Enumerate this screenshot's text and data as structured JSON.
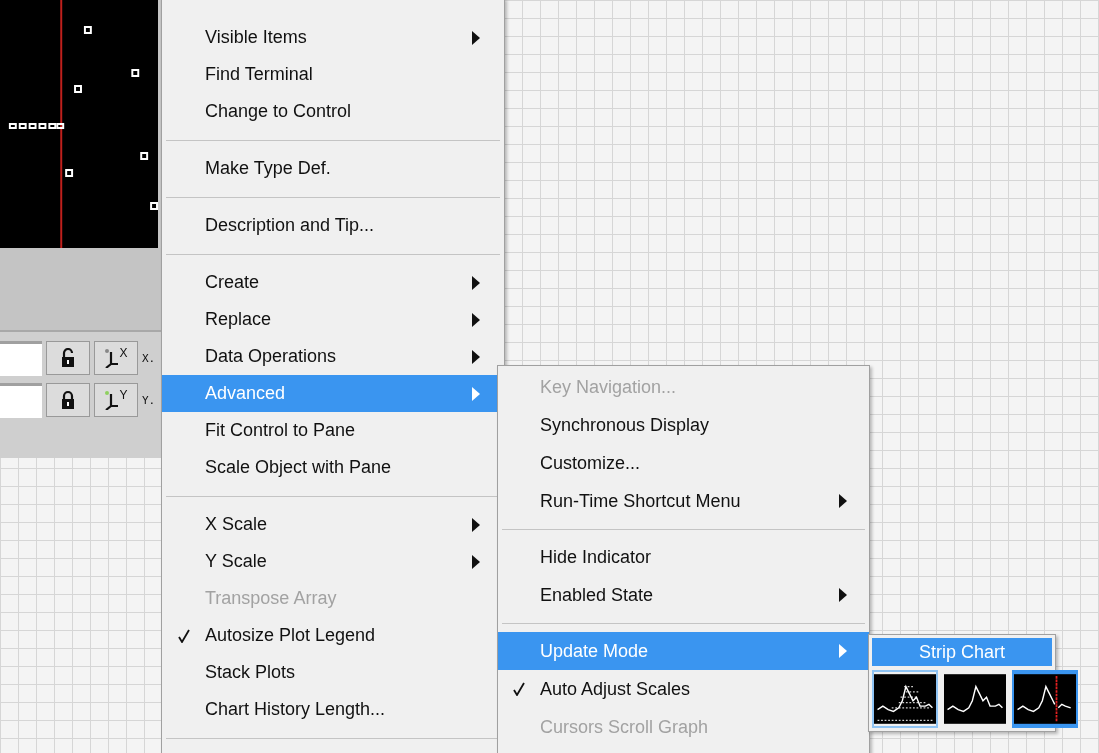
{
  "legend": [
    {
      "axis_letter": "X",
      "label": "X.",
      "locked": false
    },
    {
      "axis_letter": "Y",
      "label": "Y.",
      "locked": true
    }
  ],
  "context_menu": [
    {
      "kind": "item",
      "label": "Visible Items",
      "submenu": true,
      "disabled": false,
      "checked": false,
      "selected": false
    },
    {
      "kind": "item",
      "label": "Find Terminal",
      "submenu": false,
      "disabled": false,
      "checked": false,
      "selected": false
    },
    {
      "kind": "item",
      "label": "Change to Control",
      "submenu": false,
      "disabled": false,
      "checked": false,
      "selected": false
    },
    {
      "kind": "separator"
    },
    {
      "kind": "item",
      "label": "Make Type Def.",
      "submenu": false,
      "disabled": false,
      "checked": false,
      "selected": false
    },
    {
      "kind": "separator"
    },
    {
      "kind": "item",
      "label": "Description and Tip...",
      "submenu": false,
      "disabled": false,
      "checked": false,
      "selected": false
    },
    {
      "kind": "separator"
    },
    {
      "kind": "item",
      "label": "Create",
      "submenu": true,
      "disabled": false,
      "checked": false,
      "selected": false
    },
    {
      "kind": "item",
      "label": "Replace",
      "submenu": true,
      "disabled": false,
      "checked": false,
      "selected": false
    },
    {
      "kind": "item",
      "label": "Data Operations",
      "submenu": true,
      "disabled": false,
      "checked": false,
      "selected": false
    },
    {
      "kind": "item",
      "label": "Advanced",
      "submenu": true,
      "disabled": false,
      "checked": false,
      "selected": true
    },
    {
      "kind": "item",
      "label": "Fit Control to Pane",
      "submenu": false,
      "disabled": false,
      "checked": false,
      "selected": false
    },
    {
      "kind": "item",
      "label": "Scale Object with Pane",
      "submenu": false,
      "disabled": false,
      "checked": false,
      "selected": false
    },
    {
      "kind": "separator"
    },
    {
      "kind": "item",
      "label": "X Scale",
      "submenu": true,
      "disabled": false,
      "checked": false,
      "selected": false
    },
    {
      "kind": "item",
      "label": "Y Scale",
      "submenu": true,
      "disabled": false,
      "checked": false,
      "selected": false
    },
    {
      "kind": "item",
      "label": "Transpose Array",
      "submenu": false,
      "disabled": true,
      "checked": false,
      "selected": false
    },
    {
      "kind": "item",
      "label": "Autosize Plot Legend",
      "submenu": false,
      "disabled": false,
      "checked": true,
      "selected": false
    },
    {
      "kind": "item",
      "label": "Stack Plots",
      "submenu": false,
      "disabled": false,
      "checked": false,
      "selected": false
    },
    {
      "kind": "item",
      "label": "Chart History Length...",
      "submenu": false,
      "disabled": false,
      "checked": false,
      "selected": false
    },
    {
      "kind": "separator"
    }
  ],
  "advanced_menu": [
    {
      "kind": "item",
      "label": "Key Navigation...",
      "submenu": false,
      "disabled": true,
      "checked": false,
      "selected": false
    },
    {
      "kind": "item",
      "label": "Synchronous Display",
      "submenu": false,
      "disabled": false,
      "checked": false,
      "selected": false
    },
    {
      "kind": "item",
      "label": "Customize...",
      "submenu": false,
      "disabled": false,
      "checked": false,
      "selected": false
    },
    {
      "kind": "item",
      "label": "Run-Time Shortcut Menu",
      "submenu": true,
      "disabled": false,
      "checked": false,
      "selected": false
    },
    {
      "kind": "separator"
    },
    {
      "kind": "item",
      "label": "Hide Indicator",
      "submenu": false,
      "disabled": false,
      "checked": false,
      "selected": false
    },
    {
      "kind": "item",
      "label": "Enabled State",
      "submenu": true,
      "disabled": false,
      "checked": false,
      "selected": false
    },
    {
      "kind": "separator"
    },
    {
      "kind": "item",
      "label": "Update Mode",
      "submenu": true,
      "disabled": false,
      "checked": false,
      "selected": true
    },
    {
      "kind": "item",
      "label": "Auto Adjust Scales",
      "submenu": false,
      "disabled": false,
      "checked": true,
      "selected": false
    },
    {
      "kind": "item",
      "label": "Cursors Scroll Graph",
      "submenu": false,
      "disabled": true,
      "checked": false,
      "selected": false
    }
  ],
  "update_mode": {
    "title": "Strip Chart",
    "modes": [
      {
        "kind": "strip",
        "hovered": true,
        "selected": false
      },
      {
        "kind": "scope",
        "hovered": false,
        "selected": false
      },
      {
        "kind": "sweep",
        "hovered": false,
        "selected": true
      }
    ]
  }
}
